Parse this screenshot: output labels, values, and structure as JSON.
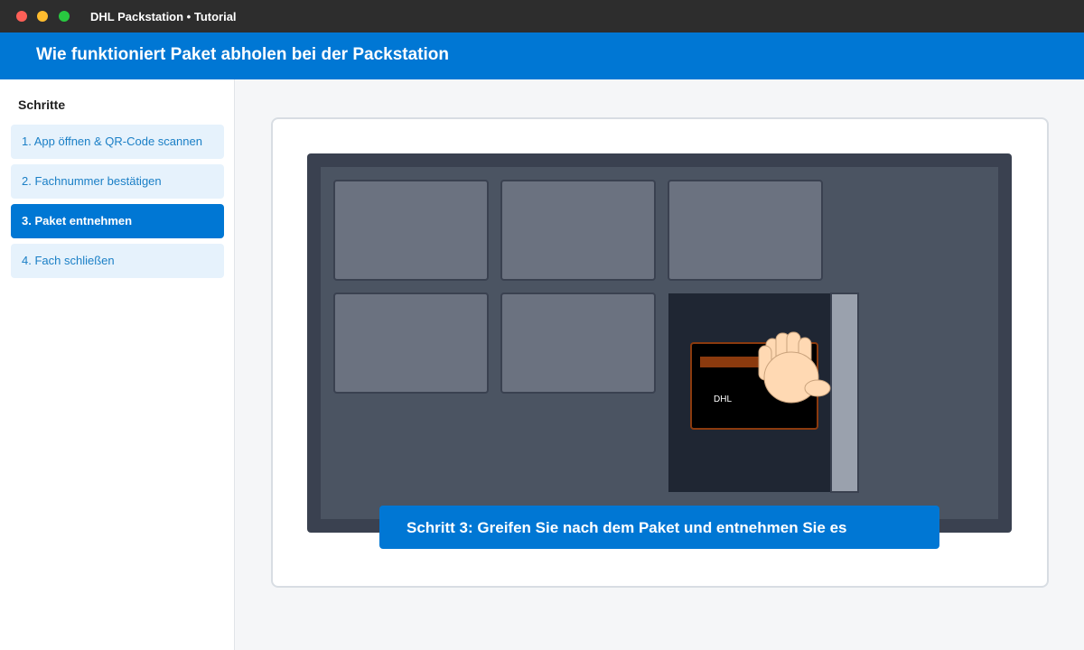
{
  "window": {
    "title": "DHL Packstation • Tutorial"
  },
  "header": {
    "title": "Wie funktioniert Paket abholen bei der Packstation"
  },
  "sidebar": {
    "heading": "Schritte",
    "steps": [
      {
        "label": "1. App öffnen & QR-Code scannen",
        "active": false
      },
      {
        "label": "2. Fachnummer bestätigen",
        "active": false
      },
      {
        "label": "3. Paket entnehmen",
        "active": true
      },
      {
        "label": "4. Fach schließen",
        "active": false
      }
    ]
  },
  "illustration": {
    "package_label": "DHL",
    "caption": "Schritt 3: Greifen Sie nach dem Paket und entnehmen Sie es"
  },
  "colors": {
    "accent": "#0077d4",
    "station_frame": "#3a4150",
    "locker_door": "#6b7280",
    "package_tape": "#8b3a0e"
  }
}
